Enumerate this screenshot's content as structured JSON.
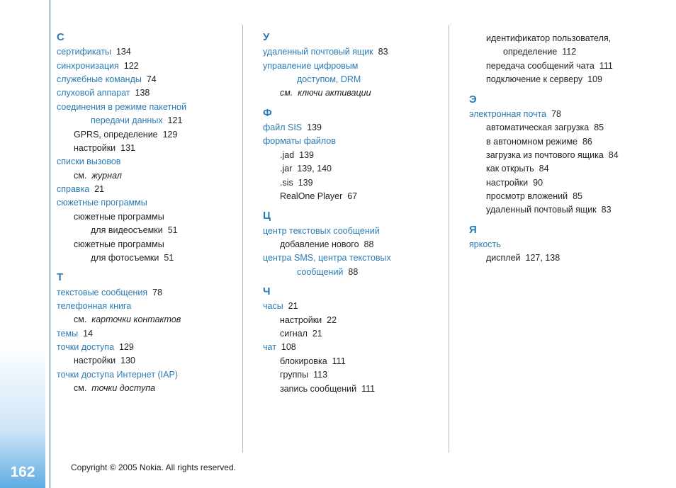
{
  "page_number": "162",
  "footer": "Copyright © 2005 Nokia. All rights reserved.",
  "col1": {
    "letters": {
      "S": "С",
      "T": "Т"
    },
    "S": {
      "e1_term": "сертификаты",
      "e1_pg": "134",
      "e2_term": "синхронизация",
      "e2_pg": "122",
      "e3_term": "служебные команды",
      "e3_pg": "74",
      "e4_term": "слуховой аппарат",
      "e4_pg": "138",
      "e5_term_line1": "соединения в режиме пакетной",
      "e5_term_line2": "передачи данных",
      "e5_pg": "121",
      "e5_sub1": "GPRS, определение",
      "e5_sub1_pg": "129",
      "e5_sub2": "настройки",
      "e5_sub2_pg": "131",
      "e6_term": "списки вызовов",
      "e6_see_label": "см.",
      "e6_see_target": "журнал",
      "e7_term": "справка",
      "e7_pg": "21",
      "e8_term": "сюжетные программы",
      "e8_sub1_line1": "сюжетные программы",
      "e8_sub1_line2": "для видеосъемки",
      "e8_sub1_pg": "51",
      "e8_sub2_line1": "сюжетные программы",
      "e8_sub2_line2": "для фотосъемки",
      "e8_sub2_pg": "51"
    },
    "T": {
      "e1_term": "текстовые сообщения",
      "e1_pg": "78",
      "e2_term": "телефонная книга",
      "e2_see_label": "см.",
      "e2_see_target": "карточки контактов",
      "e3_term": "темы",
      "e3_pg": "14",
      "e4_term": "точки доступа",
      "e4_pg": "129",
      "e4_sub1": "настройки",
      "e4_sub1_pg": "130",
      "e5_term": "точки доступа Интернет (IAP)",
      "e5_see_label": "см.",
      "e5_see_target": "точки доступа"
    }
  },
  "col2": {
    "letters": {
      "U": "У",
      "F": "Ф",
      "C": "Ц",
      "Ch": "Ч"
    },
    "U": {
      "e1_term": "удаленный почтовый ящик",
      "e1_pg": "83",
      "e2_term_line1": "управление цифровым",
      "e2_term_line2": "доступом, DRM",
      "e2_see_label": "см.",
      "e2_see_target": "ключи активации"
    },
    "F": {
      "e1_term": "файл SIS",
      "e1_pg": "139",
      "e2_term": "форматы файлов",
      "e2_sub1": ".jad",
      "e2_sub1_pg": "139",
      "e2_sub2": ".jar",
      "e2_sub2_pg": "139, 140",
      "e2_sub3": ".sis",
      "e2_sub3_pg": "139",
      "e2_sub4": "RealOne Player",
      "e2_sub4_pg": "67"
    },
    "C": {
      "e1_term": "центр текстовых сообщений",
      "e1_sub1": "добавление нового",
      "e1_sub1_pg": "88",
      "e2_term_line1": "центра SMS, центра текстовых",
      "e2_term_line2": "сообщений",
      "e2_pg": "88"
    },
    "Ch": {
      "e1_term": "часы",
      "e1_pg": "21",
      "e1_sub1": "настройки",
      "e1_sub1_pg": "22",
      "e1_sub2": "сигнал",
      "e1_sub2_pg": "21",
      "e2_term": "чат",
      "e2_pg": "108",
      "e2_sub1": "блокировка",
      "e2_sub1_pg": "111",
      "e2_sub2": "группы",
      "e2_sub2_pg": "113",
      "e2_sub3": "запись сообщений",
      "e2_sub3_pg": "111"
    }
  },
  "col3": {
    "letters": {
      "E": "Э",
      "Ya": "Я"
    },
    "top": {
      "sub1_line1": "идентификатор пользователя,",
      "sub1_line2": "определение",
      "sub1_pg": "112",
      "sub2": "передача сообщений чата",
      "sub2_pg": "111",
      "sub3": "подключение к серверу",
      "sub3_pg": "109"
    },
    "E": {
      "e1_term": "электронная почта",
      "e1_pg": "78",
      "e1_sub1": "автоматическая загрузка",
      "e1_sub1_pg": "85",
      "e1_sub2": "в автономном режиме",
      "e1_sub2_pg": "86",
      "e1_sub3": "загрузка из почтового ящика",
      "e1_sub3_pg": "84",
      "e1_sub4": "как открыть",
      "e1_sub4_pg": "84",
      "e1_sub5": "настройки",
      "e1_sub5_pg": "90",
      "e1_sub6": "просмотр вложений",
      "e1_sub6_pg": "85",
      "e1_sub7": "удаленный почтовый ящик",
      "e1_sub7_pg": "83"
    },
    "Ya": {
      "e1_term": "яркость",
      "e1_sub1": "дисплей",
      "e1_sub1_pg": "127, 138"
    }
  }
}
